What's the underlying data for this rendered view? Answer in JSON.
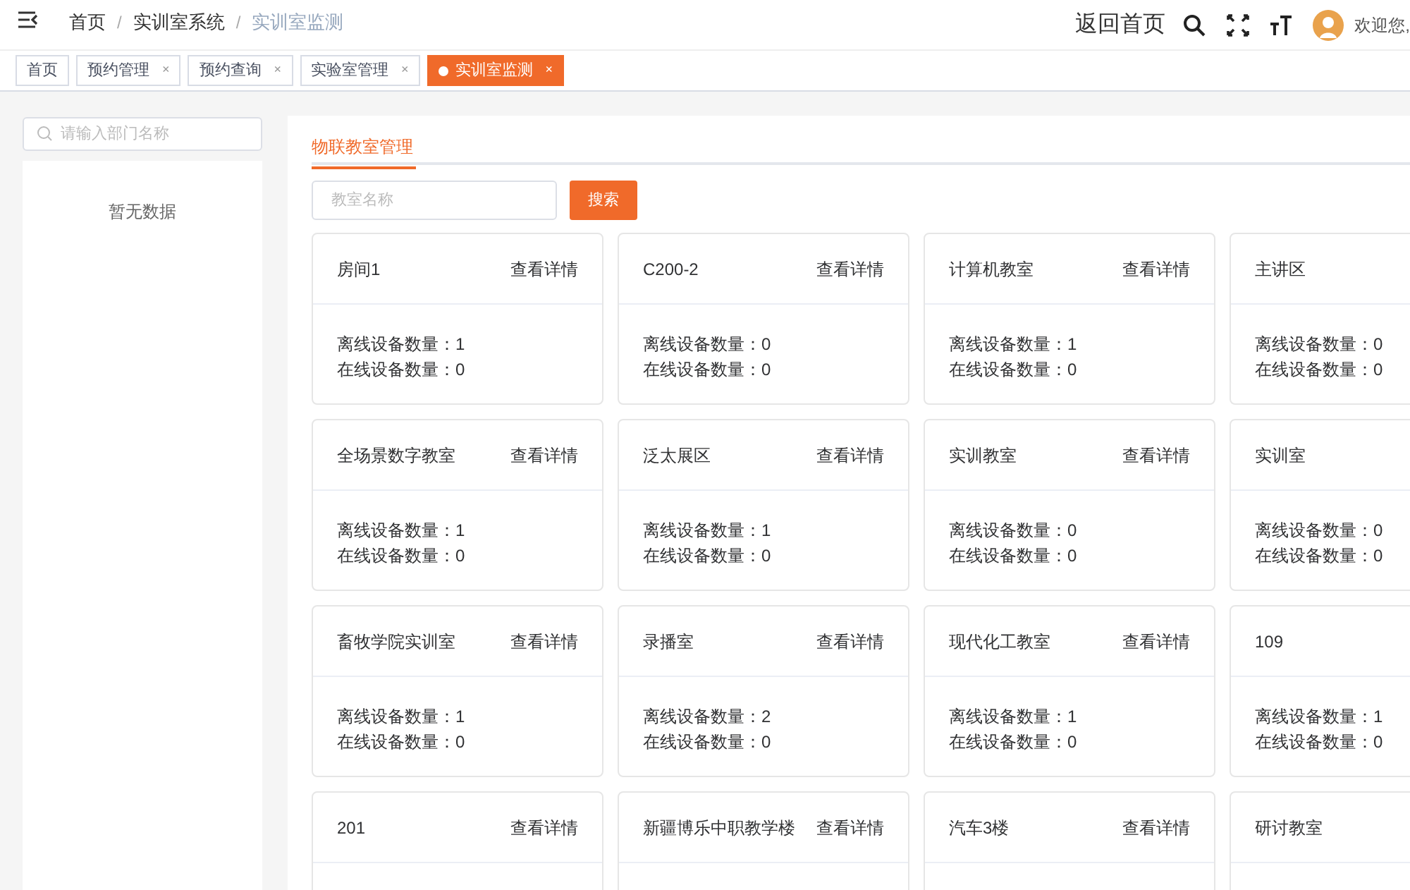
{
  "breadcrumb": [
    {
      "label": "首页"
    },
    {
      "separator": "/",
      "label": "实训室系统"
    },
    {
      "separator": "/",
      "label": "实训室监测"
    }
  ],
  "header": {
    "home_link": "返回首页",
    "welcome": "欢迎您,"
  },
  "tabs": [
    {
      "label": "首页",
      "selected": false
    },
    {
      "label": "预约管理",
      "selected": false,
      "close": "×"
    },
    {
      "label": "预约查询",
      "selected": false,
      "close": "×"
    },
    {
      "label": "实验室管理",
      "selected": false,
      "close": "×"
    },
    {
      "label": "实训室监测",
      "selected": true,
      "close": "×"
    }
  ],
  "sidebar": {
    "search_placeholder": "请输入部门名称",
    "empty_text": "暂无数据"
  },
  "main": {
    "section_tab": "物联教室管理",
    "search_placeholder": "教室名称",
    "search_button": "搜索",
    "rooms": [
      {
        "name": "房间1",
        "detail_link": "查看详情",
        "offline": "离线设备数量：1",
        "online": "在线设备数量：0"
      },
      {
        "name": "C200-2",
        "detail_link": "查看详情",
        "offline": "离线设备数量：0",
        "online": "在线设备数量：0"
      },
      {
        "name": "计算机教室",
        "detail_link": "查看详情",
        "offline": "离线设备数量：1",
        "online": "在线设备数量：0"
      },
      {
        "name": "主讲区",
        "offline": "离线设备数量：0",
        "online": "在线设备数量：0"
      },
      {
        "name": "全场景数字教室",
        "detail_link": "查看详情",
        "offline": "离线设备数量：1",
        "online": "在线设备数量：0"
      },
      {
        "name": "泛太展区",
        "detail_link": "查看详情",
        "offline": "离线设备数量：1",
        "online": "在线设备数量：0"
      },
      {
        "name": "实训教室",
        "detail_link": "查看详情",
        "offline": "离线设备数量：0",
        "online": "在线设备数量：0"
      },
      {
        "name": "实训室",
        "offline": "离线设备数量：0",
        "online": "在线设备数量：0"
      },
      {
        "name": "畜牧学院实训室",
        "detail_link": "查看详情",
        "offline": "离线设备数量：1",
        "online": "在线设备数量：0"
      },
      {
        "name": "录播室",
        "detail_link": "查看详情",
        "offline": "离线设备数量：2",
        "online": "在线设备数量：0"
      },
      {
        "name": "现代化工教室",
        "detail_link": "查看详情",
        "offline": "离线设备数量：1",
        "online": "在线设备数量：0"
      },
      {
        "name": "109",
        "offline": "离线设备数量：1",
        "online": "在线设备数量：0"
      },
      {
        "name": "201",
        "detail_link": "查看详情"
      },
      {
        "name": "新疆博乐中职教学楼",
        "detail_link": "查看详情"
      },
      {
        "name": "汽车3楼",
        "detail_link": "查看详情"
      },
      {
        "name": "研讨教室"
      }
    ]
  }
}
